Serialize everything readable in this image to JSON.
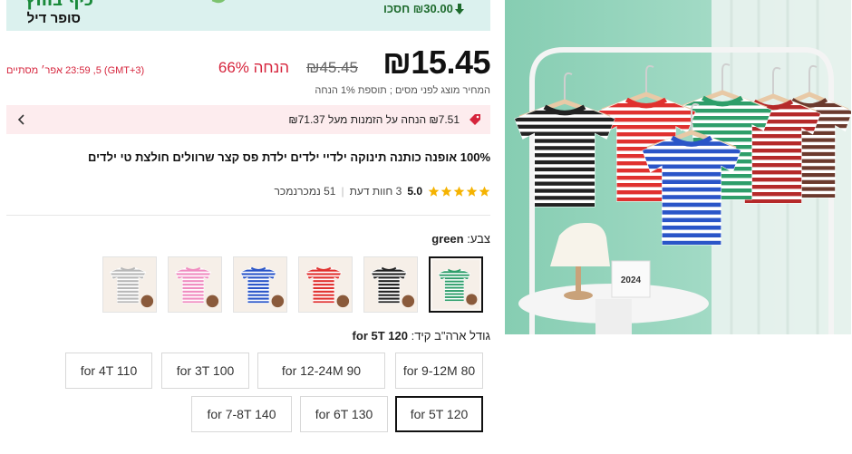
{
  "banner": {
    "deal_script": "כיף בחוץ",
    "deal_title": "סופר דיל",
    "save_text": "₪30.00 חסכו",
    "save_icon": "arrow-down-icon",
    "colors": {
      "background": "#dbf1ee",
      "save": "#1e6b2d"
    }
  },
  "price": {
    "current": "₪15.45",
    "original": "₪45.45",
    "discount": "66% הנחה",
    "ends": "(GMT+3) 23:59 ,5 אפר׳  מסתיים",
    "note": "המחיר מוצג לפני מסים ; תוספת 1% הנחה",
    "colors": {
      "discount": "#d6243c"
    }
  },
  "promo": {
    "text": "₪7.51 הנחה על הזמנות מעל ₪71.37",
    "tag_icon": "tag-icon",
    "chevron_icon": "chevron-left-icon",
    "colors": {
      "background": "#fdecee",
      "icon": "#d6243c"
    }
  },
  "product": {
    "title": "100% אופנה כותנה תינוקה ילדיי ילדים ילדת פס קצר שרוולים חולצת טי ילדים"
  },
  "rating": {
    "score": "5.0",
    "stars": 5,
    "reviews": "3 חוות דעת",
    "sold": "51 נמכרנמכר",
    "colors": {
      "star": "#f5b301"
    }
  },
  "color_picker": {
    "label": "צבע:",
    "selected": "green",
    "options": [
      {
        "name": "green",
        "stripe": "#2e9e6a"
      },
      {
        "name": "black",
        "stripe": "#222222"
      },
      {
        "name": "red",
        "stripe": "#e0312f"
      },
      {
        "name": "blue",
        "stripe": "#2a55c8"
      },
      {
        "name": "pink",
        "stripe": "#f08cc0"
      },
      {
        "name": "gray",
        "stripe": "#b8b8b8"
      }
    ]
  },
  "size_picker": {
    "label": "גודל ארה\"ב קיד:",
    "selected": "for 5T 120",
    "options": [
      "for 9-12M 80",
      "for 12-24M 90",
      "for 3T 100",
      "for 4T 110",
      "for 5T 120",
      "for 6T 130",
      "for 7-8T 140"
    ]
  },
  "image": {
    "calendar_year": "2024",
    "shirts": [
      "#222222",
      "#e0312f",
      "#2a55c8",
      "#2e9e6a",
      "#b52a2a",
      "#6b3a2e"
    ]
  }
}
